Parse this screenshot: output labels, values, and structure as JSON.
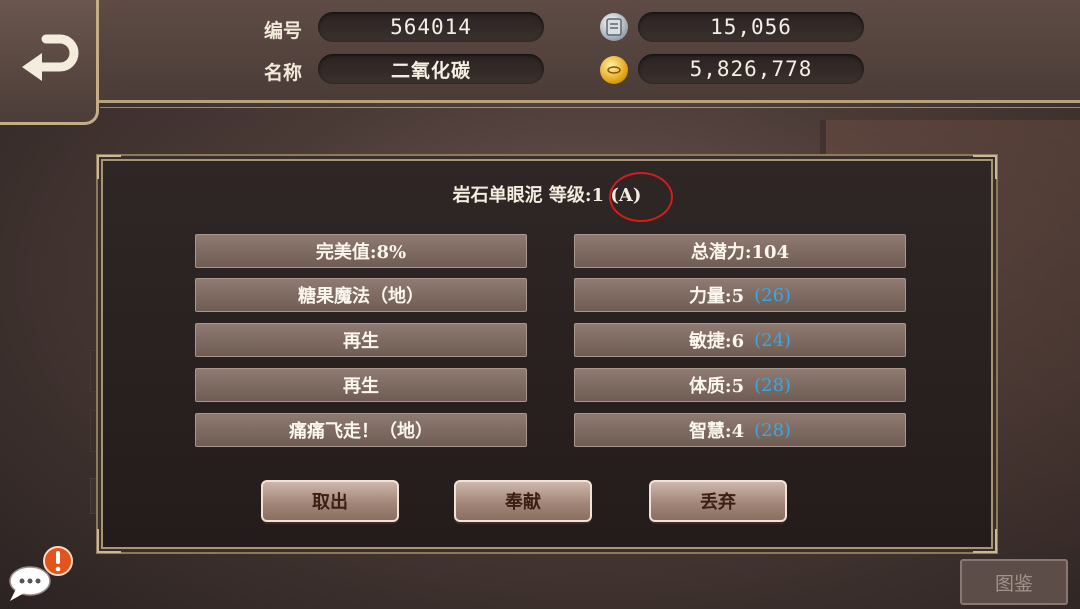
{
  "header": {
    "id_label": "编号",
    "id_value": "564014",
    "name_label": "名称",
    "name_value": "二氧化碳",
    "ticket_icon": "ticket-icon",
    "ticket_value": "15,056",
    "gold_icon": "gold-coin-icon",
    "gold_value": "5,826,778"
  },
  "modal": {
    "title": "岩石单眼泥 等级:1 (A)",
    "left_stats": [
      "完美值:8%",
      "糖果魔法（地）",
      "再生",
      "再生",
      "痛痛飞走！（地）"
    ],
    "right_stats": [
      {
        "label": "总潜力:104",
        "extra": ""
      },
      {
        "label": "力量:5",
        "extra": "(26)"
      },
      {
        "label": "敏捷:6",
        "extra": "(24)"
      },
      {
        "label": "体质:5",
        "extra": "(28)"
      },
      {
        "label": "智慧:4",
        "extra": "(28)"
      }
    ],
    "buttons": {
      "withdraw": "取出",
      "offer": "奉献",
      "discard": "丢弃"
    }
  },
  "footer": {
    "atlas_label": "图鉴"
  },
  "colors": {
    "potential_text": "#39a8e6",
    "grade_circle": "#d11d1d"
  }
}
